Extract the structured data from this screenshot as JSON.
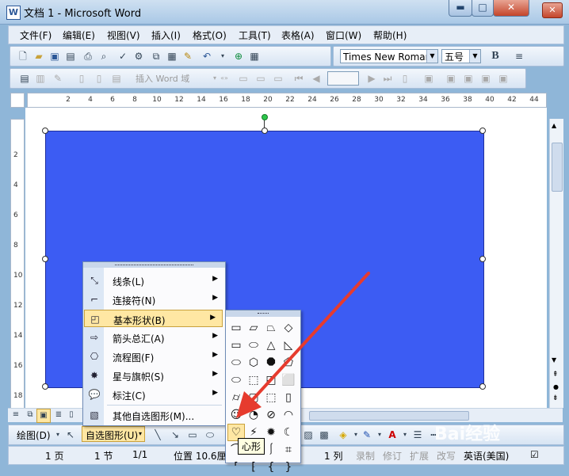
{
  "window": {
    "title": "文档 1 - Microsoft Word",
    "app_icon": "W",
    "min_glyph": "▬",
    "max_glyph": "□",
    "close_glyph": "✕",
    "doc_close_glyph": "✕"
  },
  "menubar": {
    "items": [
      "文件(F)",
      "编辑(E)",
      "视图(V)",
      "插入(I)",
      "格式(O)",
      "工具(T)",
      "表格(A)",
      "窗口(W)",
      "帮助(H)"
    ]
  },
  "toolbar_formatting": {
    "font_name": "Times New Roman",
    "font_size": "五号",
    "bold_label": "B"
  },
  "toolbar_mailmerge": {
    "insert_field_label": "插入 Word 域",
    "record_value": ""
  },
  "ruler": {
    "numbers": [
      "2",
      "4",
      "6",
      "8",
      "10",
      "12",
      "14",
      "16",
      "18",
      "20",
      "22",
      "24",
      "26",
      "28",
      "30",
      "32",
      "34",
      "36",
      "38",
      "40",
      "42",
      "44"
    ]
  },
  "vruler": {
    "numbers": [
      "2",
      "4",
      "6",
      "8",
      "10",
      "12",
      "14",
      "16",
      "18"
    ]
  },
  "autoshapes_menu": {
    "items": [
      {
        "label": "线条(L)",
        "icon": "line-icon",
        "has_submenu": true
      },
      {
        "label": "连接符(N)",
        "icon": "connector-icon",
        "has_submenu": true
      },
      {
        "label": "基本形状(B)",
        "icon": "basic-shapes-icon",
        "has_submenu": true,
        "active": true
      },
      {
        "label": "箭头总汇(A)",
        "icon": "block-arrows-icon",
        "has_submenu": true
      },
      {
        "label": "流程图(F)",
        "icon": "flowchart-icon",
        "has_submenu": true
      },
      {
        "label": "星与旗帜(S)",
        "icon": "stars-banners-icon",
        "has_submenu": true
      },
      {
        "label": "标注(C)",
        "icon": "callout-icon",
        "has_submenu": true
      },
      {
        "label": "其他自选图形(M)...",
        "icon": "more-shapes-icon",
        "has_submenu": false
      }
    ]
  },
  "basic_shapes": {
    "glyphs": [
      "▭",
      "▱",
      "⏢",
      "◇",
      "▭",
      "⬭",
      "△",
      "◺",
      "⬭",
      "⬡",
      "⯃",
      "⬠",
      "⬭",
      "⬚",
      "◰",
      "⬜",
      "⌭",
      "▢",
      "⬚",
      "▯",
      "☺",
      "◔",
      "⊘",
      "◠",
      "♡",
      "⚡",
      "✹",
      "☾",
      "⌒",
      "⌷",
      "⎰",
      "⌗",
      "⸢",
      "⁅",
      "{",
      "}"
    ],
    "hover_index": 24,
    "tooltip": "心形"
  },
  "drawing_toolbar": {
    "draw_label": "绘图(D)",
    "autoshapes_label": "自选图形(U)"
  },
  "statusbar": {
    "page": "1 页",
    "section": "1 节",
    "page_of": "1/1",
    "position": "位置 10.6厘",
    "col": "1 列",
    "rec": "录制",
    "trk": "修订",
    "ext": "扩展",
    "ovr": "改写",
    "lang": "英语(美国)"
  },
  "colors": {
    "shape_fill": "#3c5cf3",
    "menu_highlight": "#ffe7a3",
    "annotation_arrow": "#e63b2e"
  },
  "watermark": "Bai经验"
}
